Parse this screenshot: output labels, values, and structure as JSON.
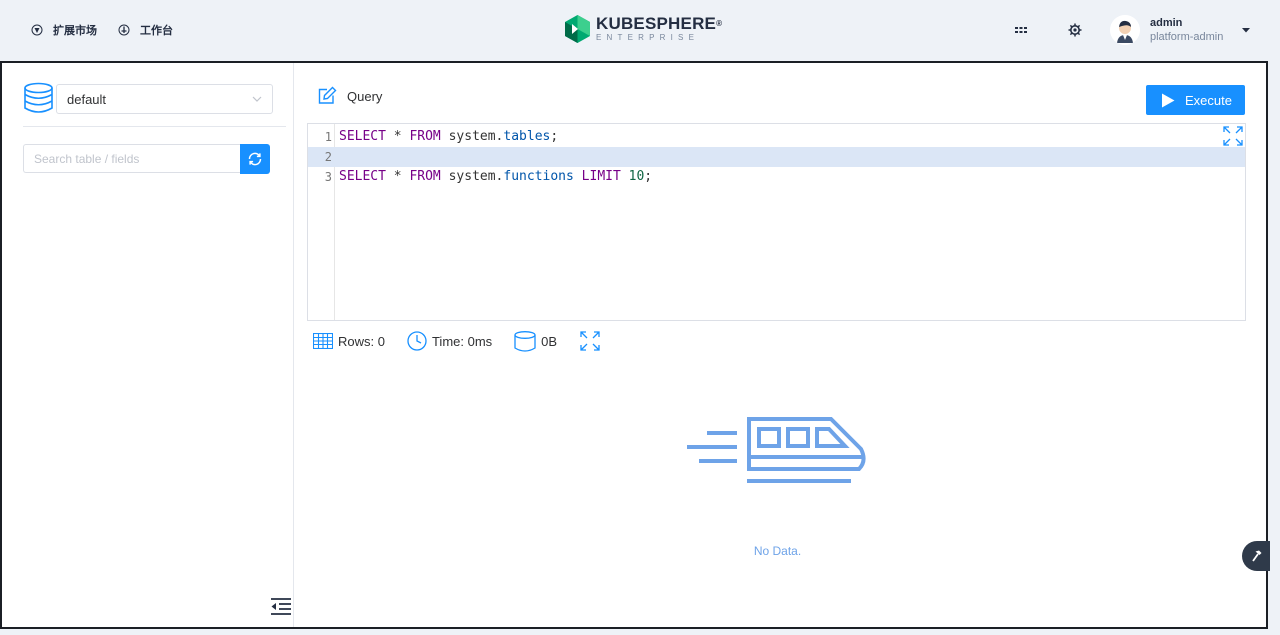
{
  "topbar": {
    "nav": [
      {
        "label": "扩展市场",
        "icon": "marketplace-icon"
      },
      {
        "label": "工作台",
        "icon": "workbench-icon"
      }
    ],
    "logo": {
      "main": "KUBESPHERE",
      "sub": "ENTERPRISE",
      "reg": "®"
    },
    "user": {
      "name": "admin",
      "role": "platform-admin"
    }
  },
  "sidebar": {
    "database": "default",
    "search_placeholder": "Search table / fields"
  },
  "main": {
    "query_label": "Query",
    "execute_label": "Execute",
    "editor_lines": [
      {
        "num": "1",
        "tokens": [
          [
            "kw",
            "SELECT"
          ],
          [
            "",
            " * "
          ],
          [
            "kw",
            "FROM"
          ],
          [
            "",
            " system."
          ],
          [
            "prop",
            "tables"
          ],
          [
            "",
            ";"
          ]
        ]
      },
      {
        "num": "2",
        "tokens": []
      },
      {
        "num": "3",
        "tokens": [
          [
            "kw",
            "SELECT"
          ],
          [
            "",
            " * "
          ],
          [
            "kw",
            "FROM"
          ],
          [
            "",
            " system."
          ],
          [
            "prop",
            "functions"
          ],
          [
            "",
            " "
          ],
          [
            "kw",
            "LIMIT"
          ],
          [
            "",
            " "
          ],
          [
            "num",
            "10"
          ],
          [
            "",
            ";"
          ]
        ]
      }
    ],
    "active_line": 2,
    "stats": {
      "rows": "Rows: 0",
      "time": "Time: 0ms",
      "size": "0B"
    },
    "empty_text": "No Data."
  },
  "colors": {
    "accent": "#1890ff",
    "empty": "#6ea3e8",
    "keyword": "#770088",
    "property": "#0055aa",
    "number": "#116644"
  }
}
